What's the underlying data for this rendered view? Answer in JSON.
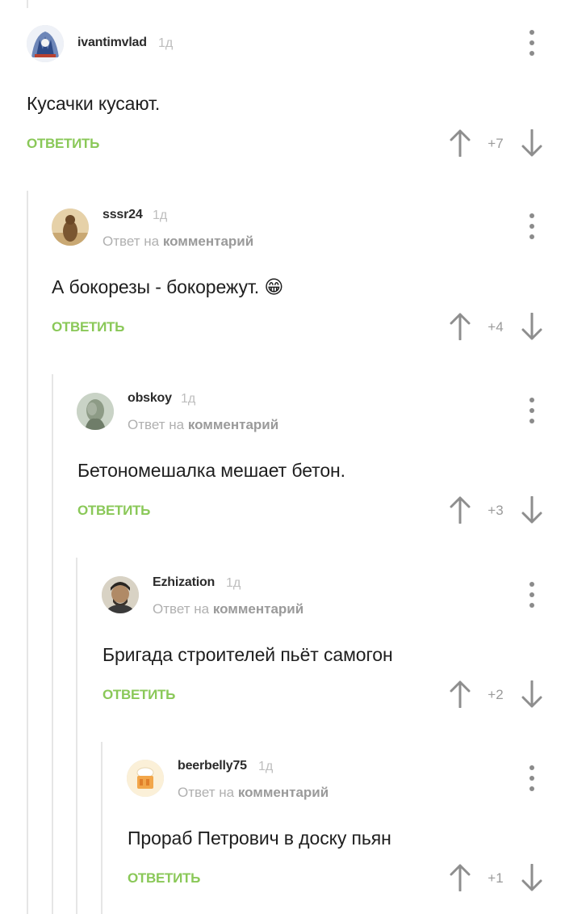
{
  "reply_prefix": "Ответ на",
  "reply_target": "комментарий",
  "reply_label": "ОТВЕТИТЬ",
  "colors": {
    "reply_green": "#8ac858",
    "thread_line": "#e6e6e6",
    "muted": "#b0b0b0"
  },
  "comments": [
    {
      "username": "ivantimvlad",
      "time": "1д",
      "text": "Кусачки кусают.",
      "rating": "+7",
      "is_reply": false
    },
    {
      "username": "sssr24",
      "time": "1д",
      "text": "А бокорезы - бокорежут.",
      "emoji": "😁",
      "rating": "+4",
      "is_reply": true
    },
    {
      "username": "obskoy",
      "time": "1д",
      "text": "Бетономешалка мешает бетон.",
      "rating": "+3",
      "is_reply": true
    },
    {
      "username": "Ezhization",
      "time": "1д",
      "text": "Бригада строителей пьёт самогон",
      "rating": "+2",
      "is_reply": true
    },
    {
      "username": "beerbelly75",
      "time": "1д",
      "text": "Прораб Петрович в доску пьян",
      "rating": "+1",
      "is_reply": true
    }
  ]
}
